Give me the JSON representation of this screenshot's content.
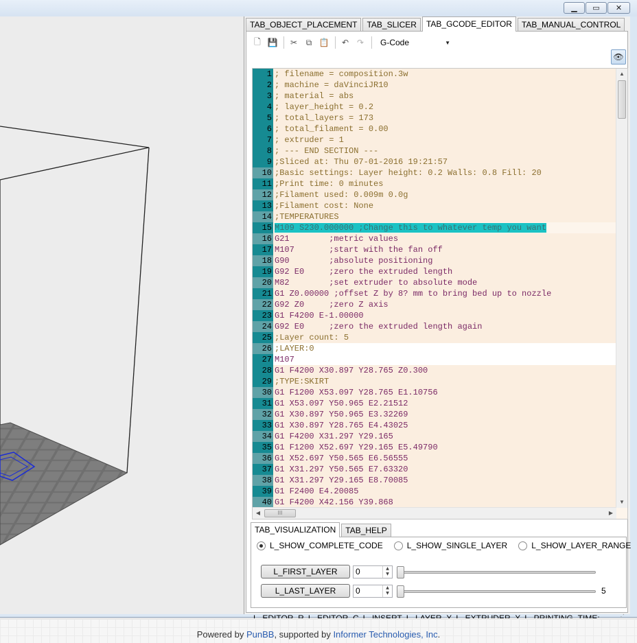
{
  "window": {
    "controls": {
      "minimize_icon": "minimize-icon",
      "maximize_icon": "maximize-icon",
      "close_icon": "close-icon"
    }
  },
  "tabs": [
    "TAB_OBJECT_PLACEMENT",
    "TAB_SLICER",
    "TAB_GCODE_EDITOR",
    "TAB_MANUAL_CONTROL"
  ],
  "active_tab": "TAB_GCODE_EDITOR",
  "toolbar": {
    "language": "G-Code",
    "icons": [
      "new-file-icon",
      "save-icon",
      "cut-icon",
      "copy-icon",
      "paste-icon",
      "undo-icon",
      "redo-icon",
      "eye-icon"
    ]
  },
  "editor": {
    "current_line": 15,
    "lines": [
      "; filename = composition.3w",
      "; machine = daVinciJR10",
      "; material = abs",
      "; layer_height = 0.2",
      "; total_layers = 173",
      "; total_filament = 0.00",
      "; extruder = 1",
      "; --- END SECTION ---",
      ";Sliced at: Thu 07-01-2016 19:21:57",
      ";Basic settings: Layer height: 0.2 Walls: 0.8 Fill: 20",
      ";Print time: 0 minutes",
      ";Filament used: 0.009m 0.0g",
      ";Filament cost: None",
      ";TEMPERATURES",
      "M109 S230.000000 ;Change this to whatever temp you want",
      "G21        ;metric values",
      "M107       ;start with the fan off",
      "G90        ;absolute positioning",
      "G92 E0     ;zero the extruded length",
      "M82        ;set extruder to absolute mode",
      "G1 Z0.00000 ;offset Z by 8? mm to bring bed up to nozzle",
      "G92 Z0     ;zero Z axis",
      "G1 F4200 E-1.00000",
      "G92 E0     ;zero the extruded length again",
      ";Layer count: 5",
      ";LAYER:0",
      "M107",
      "G1 F4200 X30.897 Y28.765 Z0.300",
      ";TYPE:SKIRT",
      "G1 F1200 X53.097 Y28.765 E1.10756",
      "G1 X53.097 Y50.965 E2.21512",
      "G1 X30.897 Y50.965 E3.32269",
      "G1 X30.897 Y28.765 E4.43025",
      "G1 F4200 X31.297 Y29.165",
      "G1 F1200 X52.697 Y29.165 E5.49790",
      "G1 X52.697 Y50.565 E6.56555",
      "G1 X31.297 Y50.565 E7.63320",
      "G1 X31.297 Y29.165 E8.70085",
      "G1 F2400 E4.20085",
      "G1 F4200 X42.156 Y39.868"
    ],
    "hscroll_label": "III"
  },
  "viz": {
    "tabs": [
      "TAB_VISUALIZATION",
      "TAB_HELP"
    ],
    "radios": [
      {
        "label": "L_SHOW_COMPLETE_CODE",
        "checked": true
      },
      {
        "label": "L_SHOW_SINGLE_LAYER",
        "checked": false
      },
      {
        "label": "L_SHOW_LAYER_RANGE",
        "checked": false
      }
    ],
    "first_layer": {
      "button": "L_FIRST_LAYER",
      "value": "0"
    },
    "last_layer": {
      "button": "L_LAST_LAYER",
      "value": "0",
      "max_label": "5"
    }
  },
  "status": [
    "L_EDITOR_R",
    "L_EDITOR_C",
    "L_INSERT",
    "L_LAYER_X",
    "L_EXTRUDER_X",
    "L_PRINTING_TIME:"
  ],
  "footer": {
    "prefix": "Powered by ",
    "link1": "PunBB",
    "middle": ", supported by ",
    "link2": "Informer Technologies, Inc",
    "suffix": "."
  }
}
